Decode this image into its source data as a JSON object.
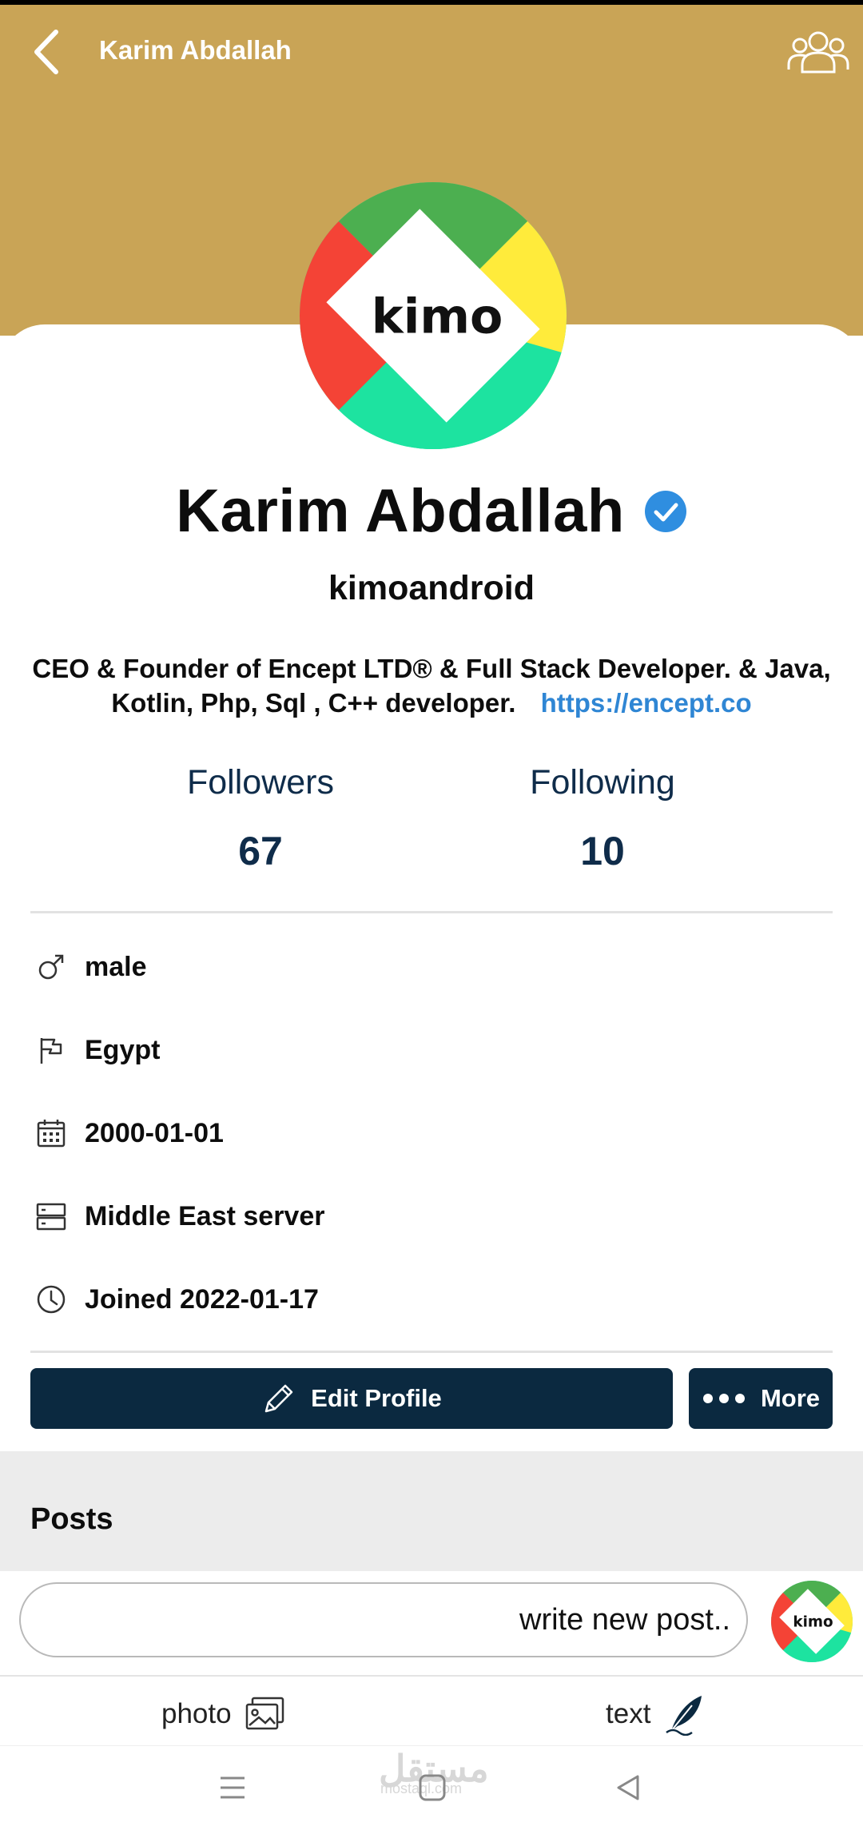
{
  "topbar": {
    "title": "Karim Abdallah"
  },
  "profile": {
    "avatar_text": "kimo",
    "name": "Karim Abdallah",
    "username": "kimoandroid",
    "bio_line1": "CEO & Founder of Encept LTD® & Full Stack Developer. & Java,",
    "bio_line2": "Kotlin, Php, Sql , C++ developer.",
    "bio_link": "https://encept.co"
  },
  "stats": {
    "followers_label": "Followers",
    "followers_value": "67",
    "following_label": "Following",
    "following_value": "10"
  },
  "info": {
    "gender": "male",
    "country": "Egypt",
    "birthdate": "2000-01-01",
    "server": "Middle East server",
    "joined": "Joined 2022-01-17"
  },
  "buttons": {
    "edit_profile": "Edit Profile",
    "more": "More"
  },
  "posts": {
    "title": "Posts",
    "input_text": "write new post..",
    "photo_label": "photo",
    "text_label": "text"
  },
  "watermark": {
    "text": "مستقل",
    "sub": "mostaql.com"
  },
  "colors": {
    "gold": "#c9a456",
    "navy": "#0b2940",
    "link": "#2f86d4",
    "verified": "#2f8ee0"
  },
  "icons": [
    "back-icon",
    "group-icon",
    "verified-icon",
    "male-icon",
    "flag-icon",
    "calendar-icon",
    "server-icon",
    "clock-icon",
    "pencil-icon",
    "dots-icon",
    "photo-icon",
    "feather-icon",
    "menu-icon",
    "home-icon",
    "back-triangle-icon"
  ]
}
